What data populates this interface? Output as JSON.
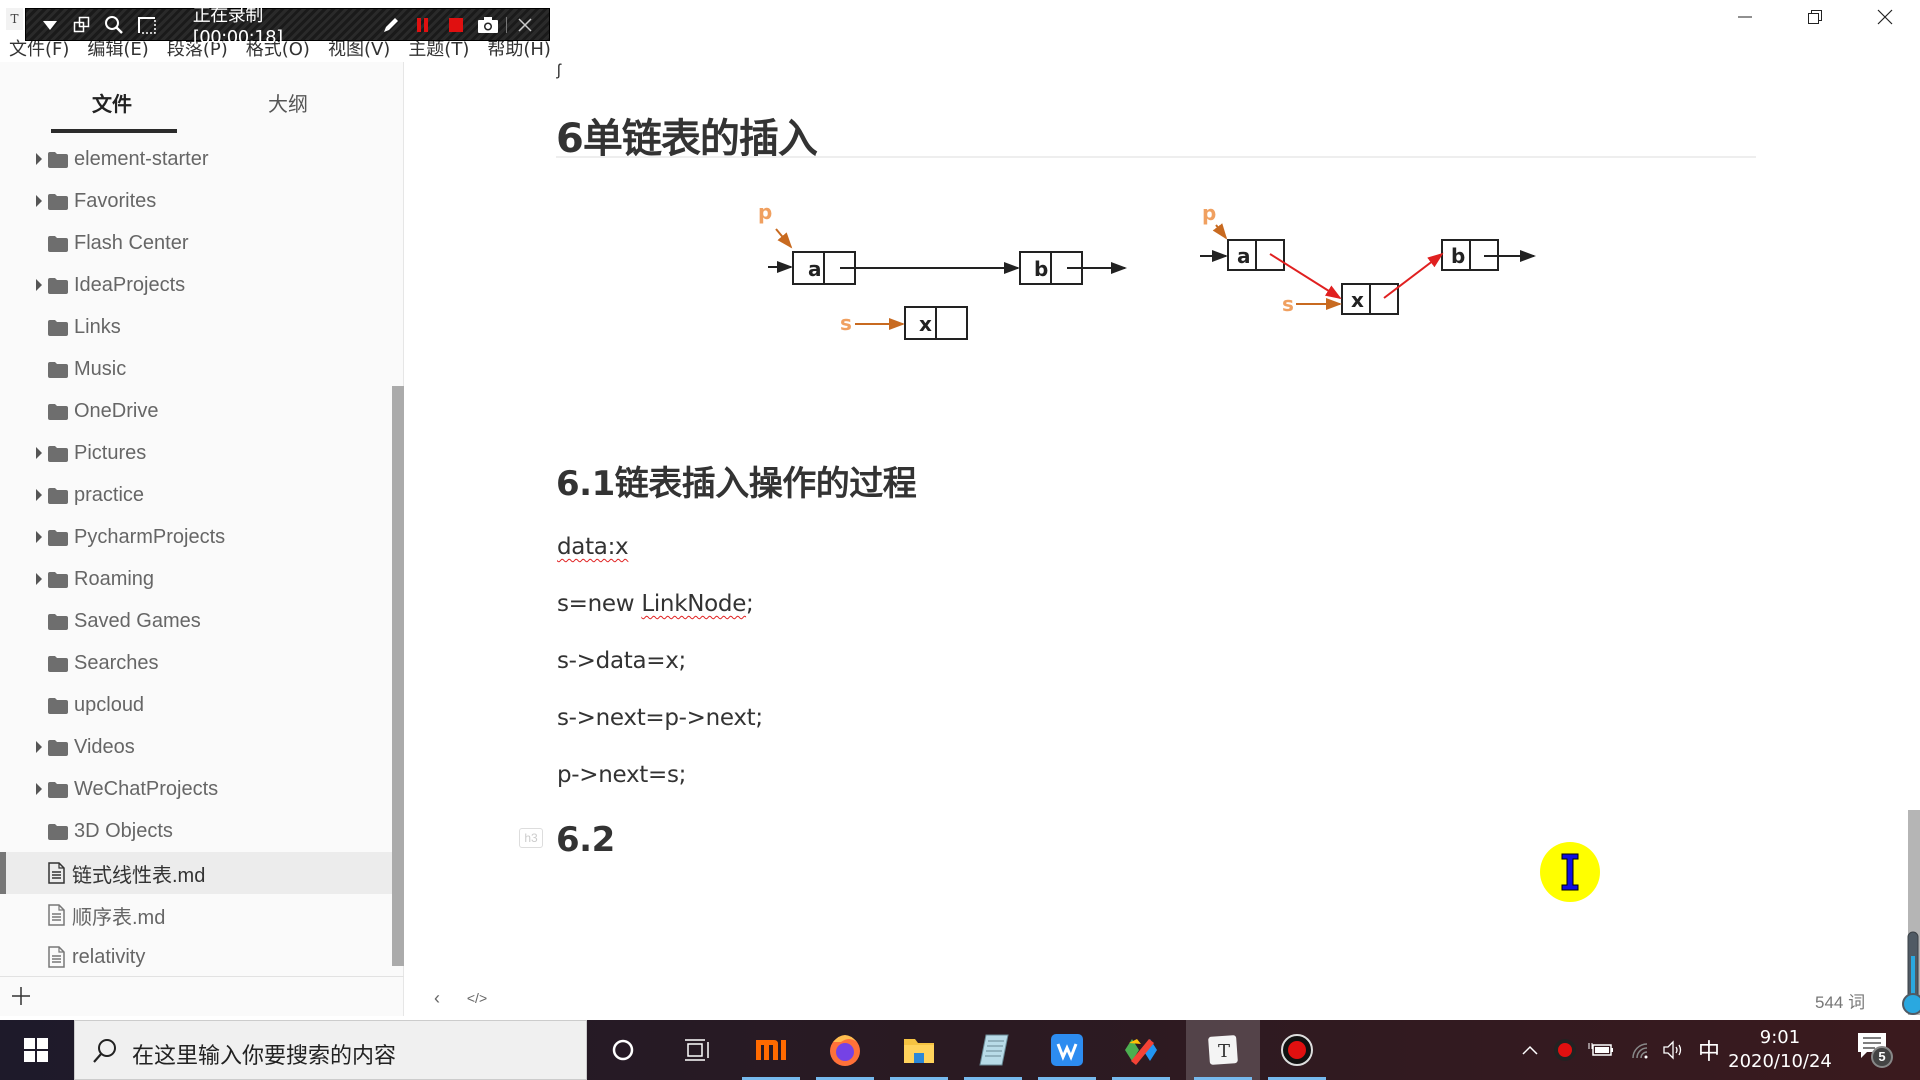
{
  "window": {
    "app_icon_letter": "T",
    "controls": [
      "minimize",
      "restore",
      "close"
    ]
  },
  "recorder": {
    "status": "正在录制 [00:00:18]",
    "buttons": [
      "dropdown",
      "window-mode",
      "zoom",
      "region",
      "pen",
      "pause",
      "stop",
      "screenshot",
      "close"
    ]
  },
  "menu": [
    {
      "label": "文件(F)"
    },
    {
      "label": "编辑(E)"
    },
    {
      "label": "段落(P)"
    },
    {
      "label": "格式(O)"
    },
    {
      "label": "视图(V)"
    },
    {
      "label": "主题(T)"
    },
    {
      "label": "帮助(H)"
    }
  ],
  "sidebar": {
    "tabs": [
      {
        "label": "文件",
        "active": true
      },
      {
        "label": "大纲",
        "active": false
      }
    ],
    "items": [
      {
        "label": "element-starter",
        "type": "folder",
        "expandable": true
      },
      {
        "label": "Favorites",
        "type": "folder",
        "expandable": true
      },
      {
        "label": "Flash Center",
        "type": "folder",
        "expandable": false
      },
      {
        "label": "IdeaProjects",
        "type": "folder",
        "expandable": true
      },
      {
        "label": "Links",
        "type": "folder",
        "expandable": false
      },
      {
        "label": "Music",
        "type": "folder",
        "expandable": false
      },
      {
        "label": "OneDrive",
        "type": "folder",
        "expandable": false
      },
      {
        "label": "Pictures",
        "type": "folder",
        "expandable": true
      },
      {
        "label": "practice",
        "type": "folder",
        "expandable": true
      },
      {
        "label": "PycharmProjects",
        "type": "folder",
        "expandable": true
      },
      {
        "label": "Roaming",
        "type": "folder",
        "expandable": true
      },
      {
        "label": "Saved Games",
        "type": "folder",
        "expandable": false
      },
      {
        "label": "Searches",
        "type": "folder",
        "expandable": false
      },
      {
        "label": "upcloud",
        "type": "folder",
        "expandable": false
      },
      {
        "label": "Videos",
        "type": "folder",
        "expandable": true
      },
      {
        "label": "WeChatProjects",
        "type": "folder",
        "expandable": true
      },
      {
        "label": "3D Objects",
        "type": "folder",
        "expandable": false
      },
      {
        "label": "链式线性表.md",
        "type": "file",
        "active": true
      },
      {
        "label": "顺序表.md",
        "type": "file"
      },
      {
        "label": "relativity",
        "type": "file"
      }
    ],
    "add_label": "+"
  },
  "editor": {
    "stray_char": "ʃ",
    "heading_main": "6单链表的插入",
    "diagram": {
      "before": {
        "pointer_p": "p",
        "pointer_s": "s",
        "nodes": [
          "a",
          "b",
          "x"
        ]
      },
      "after": {
        "pointer_p": "p",
        "pointer_s": "s",
        "nodes": [
          "a",
          "x",
          "b"
        ]
      },
      "colors": {
        "pointer": "#e8873a",
        "new_link": "#e02020",
        "node": "#222222"
      }
    },
    "heading_61": "6.1链表插入操作的过程",
    "lines": [
      {
        "text": "data:x",
        "spellcheck": true
      },
      {
        "pre": "s=new ",
        "flagged": "LinkNode",
        "post": ";"
      },
      {
        "text": "s->data=x;"
      },
      {
        "text": "s->next=p->next;"
      },
      {
        "text": "p->next=s;"
      }
    ],
    "heading_62": "6.2",
    "heading_62_badge": "h3"
  },
  "status": {
    "back_icon": "‹",
    "source_icon": "</>",
    "word_count": "544 词"
  },
  "taskbar": {
    "search_placeholder": "在这里输入你要搜索的内容",
    "apps": [
      "cortana",
      "task-view",
      "mi",
      "firefox",
      "file-explorer",
      "notepad",
      "wps",
      "app-colorful",
      "typora",
      "recorder"
    ],
    "tray": {
      "ime": "中",
      "time": "9:01",
      "date": "2020/10/24",
      "notifications": "5"
    }
  }
}
